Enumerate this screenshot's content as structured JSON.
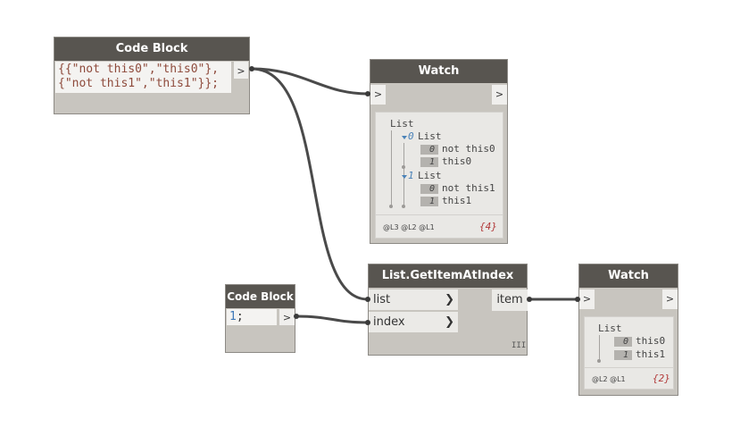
{
  "code_block_1": {
    "title": "Code Block",
    "lines": [
      "{{\"not this0\",\"this0\"},",
      "{\"not this1\",\"this1\"}};"
    ],
    "out_port": ">"
  },
  "watch_1": {
    "title": "Watch",
    "in_port": ">",
    "out_port": ">",
    "root_label": "List",
    "sub0_index": "0",
    "sub0_label": "List",
    "item00_index": "0",
    "item00_value": "not this0",
    "item01_index": "1",
    "item01_value": "this0",
    "sub1_index": "1",
    "sub1_label": "List",
    "item10_index": "0",
    "item10_value": "not this1",
    "item11_index": "1",
    "item11_value": "this1",
    "levels": "@L3 @L2 @L1",
    "count": "{4}"
  },
  "code_block_2": {
    "title": "Code Block",
    "value": "1",
    "terminator": ";",
    "out_port": ">"
  },
  "get_item": {
    "title": "List.GetItemAtIndex",
    "in_list": "list",
    "in_index": "index",
    "out_item": "item",
    "chevron": "❯",
    "lacing": "III"
  },
  "watch_2": {
    "title": "Watch",
    "in_port": ">",
    "out_port": ">",
    "root_label": "List",
    "item0_index": "0",
    "item0_value": "this0",
    "item1_index": "1",
    "item1_value": "this1",
    "levels": "@L2 @L1",
    "count": "{2}"
  },
  "colors": {
    "header": "#585550",
    "node_body": "#c8c5bf",
    "wire": "#4a4a4a",
    "string": "#8e4a3b",
    "number": "#3d78b8",
    "count": "#b23a3a"
  }
}
